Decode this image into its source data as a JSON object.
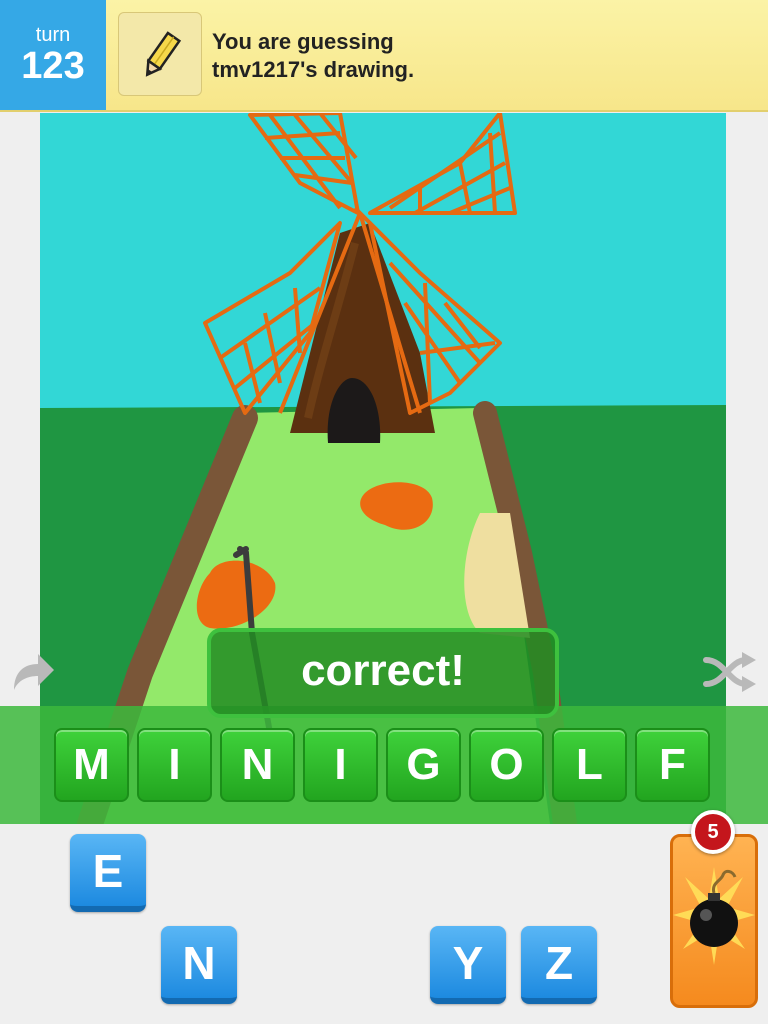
{
  "header": {
    "turn_label": "turn",
    "turn_number": "123",
    "status_line1": "You are guessing",
    "status_line2": "tmv1217's drawing."
  },
  "result": {
    "message": "correct!",
    "answer_letters": [
      "M",
      "I",
      "N",
      "I",
      "G",
      "O",
      "L",
      "F"
    ]
  },
  "letter_keys": [
    "E",
    "N",
    "Y",
    "Z"
  ],
  "bomb": {
    "count": "5",
    "icon": "bomb-icon"
  },
  "icons": {
    "pass": "pass-arrow-icon",
    "shuffle": "shuffle-icon",
    "pencil": "pencil-icon"
  },
  "colors": {
    "turn_blue": "#35a8e6",
    "header_yellow": "#fbf3a6",
    "correct_green": "#2fb52c",
    "key_blue": "#2a97e8",
    "bomb_orange": "#f89a2a",
    "badge_red": "#c4161c"
  }
}
